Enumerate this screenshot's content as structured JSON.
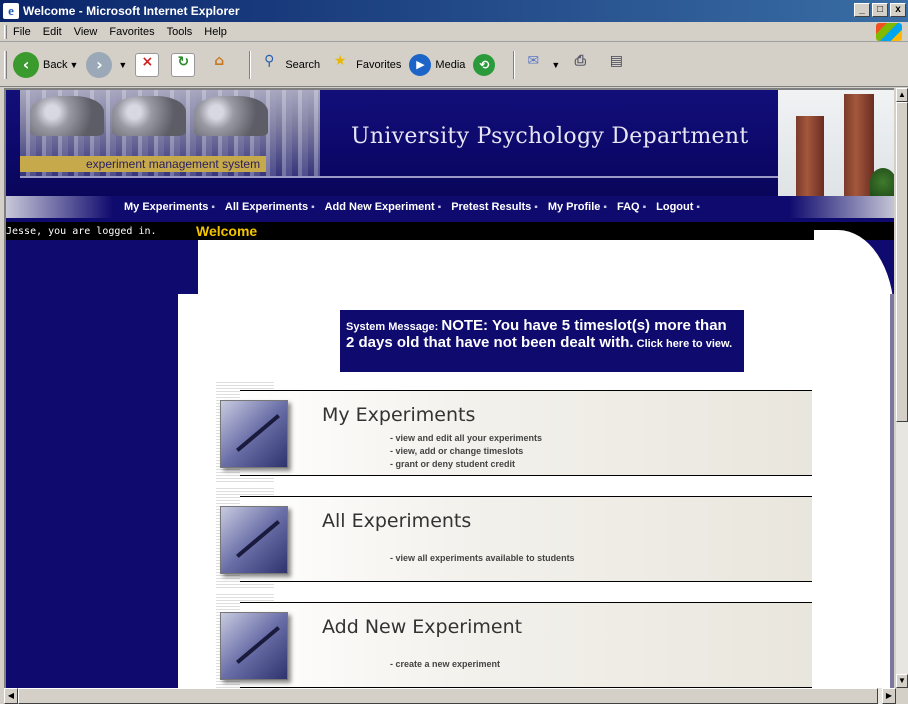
{
  "window": {
    "title": "Welcome - Microsoft Internet Explorer",
    "controls": [
      "_",
      "□",
      "x"
    ]
  },
  "menu": [
    "File",
    "Edit",
    "View",
    "Favorites",
    "Tools",
    "Help"
  ],
  "toolbar": {
    "back": "Back",
    "search": "Search",
    "favorites": "Favorites",
    "media": "Media"
  },
  "header": {
    "system_name": "experiment management system",
    "department": "University Psychology Department"
  },
  "nav": [
    {
      "label": "My Experiments"
    },
    {
      "label": "All Experiments"
    },
    {
      "label": "Add New Experiment"
    },
    {
      "label": "Pretest Results"
    },
    {
      "label": "My Profile"
    },
    {
      "label": "FAQ"
    },
    {
      "label": "Logout"
    }
  ],
  "status": {
    "logged_in": "Jesse, you are logged in.",
    "page_title": "Welcome"
  },
  "system_message": {
    "prefix": "System Message:",
    "note": "NOTE: You have 5 timeslot(s) more than 2 days old that have not been dealt with.",
    "link": "Click here to view."
  },
  "cards": [
    {
      "title": "My Experiments",
      "items": [
        "- view and edit all your experiments",
        "- view, add or change timeslots",
        "- grant or deny student credit"
      ]
    },
    {
      "title": "All Experiments",
      "items": [
        "- view all experiments available to students"
      ]
    },
    {
      "title": "Add New Experiment",
      "items": [
        "- create a new experiment"
      ]
    }
  ],
  "colors": {
    "navy": "#0f0a6e",
    "gold": "#f5c400",
    "band": "#c6a94a"
  }
}
